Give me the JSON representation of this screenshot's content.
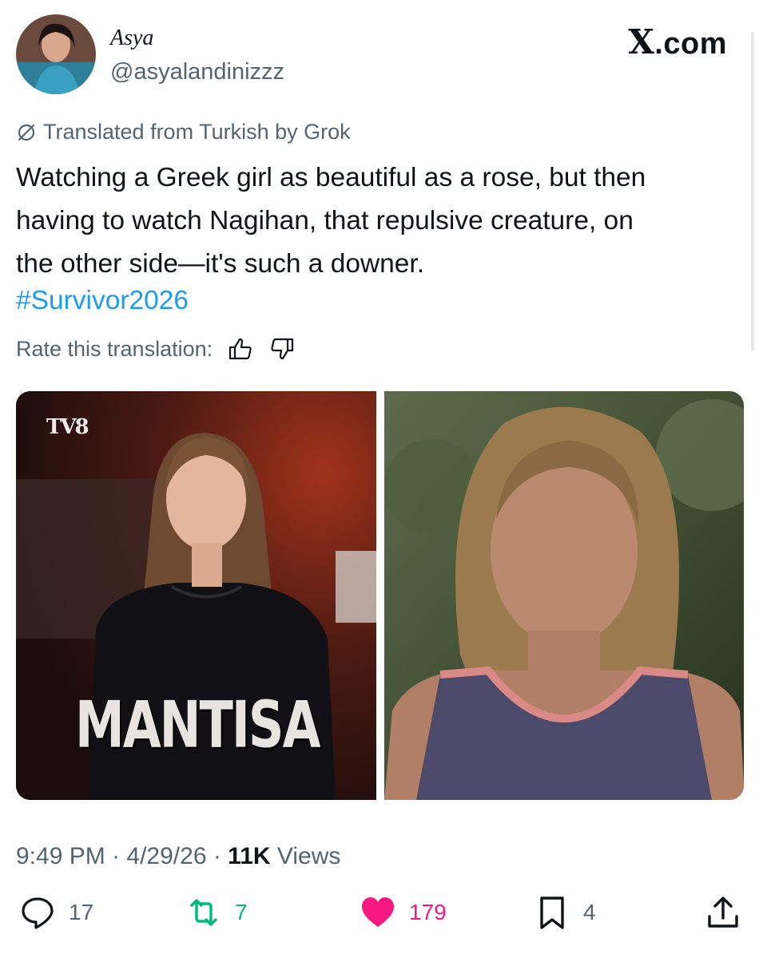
{
  "author": {
    "display_name": "Asya",
    "handle": "@asyalandinizzz",
    "avatar_icon": "profile-photo"
  },
  "site_logo": {
    "x": "X",
    "suffix": ".com"
  },
  "translation": {
    "note": "Translated from Turkish by Grok",
    "text": "Watching a Greek girl as beautiful as a rose, but then\nhaving to watch Nagihan, that repulsive creature, on\nthe other side—it's such a downer.",
    "hashtag": "#Survivor2026",
    "rate_label": "Rate this translation:"
  },
  "media": {
    "left": {
      "channel_logo": "TV8",
      "caption": "MANTISA"
    },
    "right": {
      "caption": ""
    }
  },
  "meta": {
    "time": "9:49 PM",
    "date": "4/29/26",
    "views_count": "11K",
    "views_label": "Views"
  },
  "actions": {
    "replies": "17",
    "reposts": "7",
    "likes": "179",
    "bookmarks": "4"
  },
  "colors": {
    "text": "#0f1419",
    "secondary": "#536471",
    "link": "#1d9bf0",
    "repost": "#00ba7c",
    "like": "#f91880"
  }
}
